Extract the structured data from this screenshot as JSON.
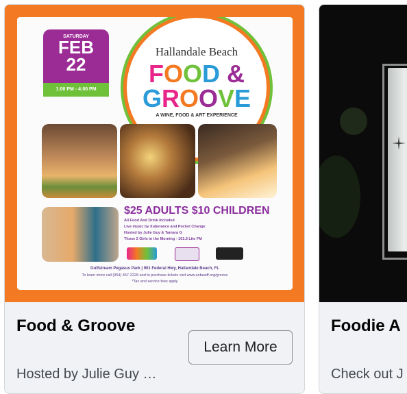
{
  "cards": [
    {
      "title": "Food & Groove",
      "subtitle": "Hosted by Julie Guy …",
      "button_label": "Learn More",
      "poster": {
        "date_day": "SATURDAY",
        "date_month": "FEB",
        "date_num": "22",
        "time": "1:00 PM - 4:00 PM",
        "venue": "Hallandale Beach",
        "logo_word1": "FOOD &",
        "logo_word2": "GROOVE",
        "tagline": "A WINE, FOOD & ART EXPERIENCE",
        "price_line": "$25 ADULTS $10 CHILDREN",
        "details": [
          "All Food And Drink Included",
          "Live music by Xuberance and Pocket Change",
          "Hosted by Julie Guy & Tamara G",
          "Those 2 Girls in the Morning - 101.5 Lite FM"
        ],
        "footer_lines": [
          "Gulfstream Pegasus Park | 901 Federal Hwy, Hallandale Beach, FL",
          "To learn more call (954) 457-2228 and to purchase tickets visit www.sobewff.org/groove",
          "*Tax and service fees apply"
        ]
      }
    },
    {
      "title": "Foodie A",
      "subtitle": "Check out J"
    }
  ],
  "colors": {
    "poster_bg": "#f37a22",
    "purple": "#9b2b95",
    "green": "#6fc13a",
    "card_bg": "#f0f2f5"
  }
}
